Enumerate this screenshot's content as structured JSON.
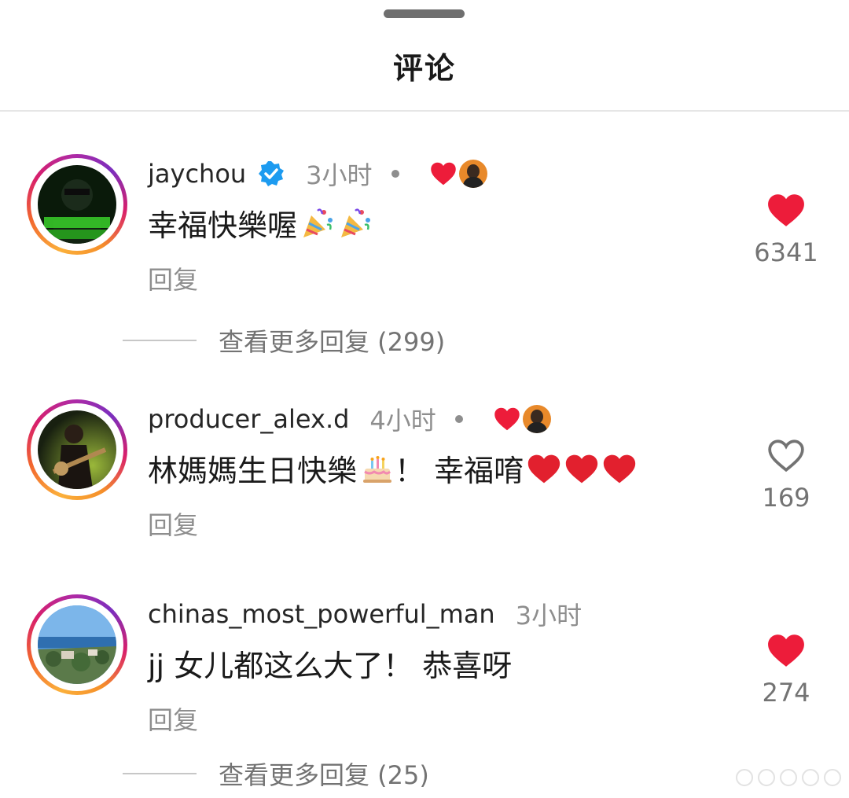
{
  "sheet": {
    "title": "评论"
  },
  "comments": [
    {
      "username": "jaychou",
      "verified": true,
      "time": "3小时",
      "author_liked": true,
      "text": "幸福快樂喔",
      "emojis": [
        "party-popper",
        "party-popper"
      ],
      "reply_label": "回复",
      "likes": "6341",
      "liked": true,
      "view_more": "查看更多回复 (299)"
    },
    {
      "username": "producer_alex.d",
      "verified": false,
      "time": "4小时",
      "author_liked": true,
      "text_part1": "林媽媽生日快樂",
      "text_part2": "！ 幸福唷",
      "emojis": [
        "birthday-cake",
        "red-heart",
        "red-heart",
        "red-heart"
      ],
      "reply_label": "回复",
      "likes": "169",
      "liked": false
    },
    {
      "username": "chinas_most_powerful_man",
      "verified": false,
      "time": "3小时",
      "author_liked": false,
      "text": "jj 女儿都这么大了！ 恭喜呀",
      "reply_label": "回复",
      "likes": "274",
      "liked": true,
      "view_more": "查看更多回复 (25)"
    }
  ],
  "colors": {
    "heart_red": "#ed1c3a",
    "verified_blue": "#1d9bf0",
    "muted_text": "#8e8e8e"
  }
}
